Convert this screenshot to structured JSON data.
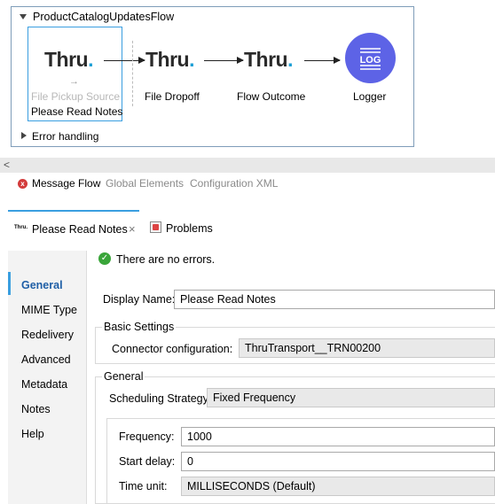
{
  "canvas": {
    "flow_name": "ProductCatalogUpdatesFlow",
    "nodes": [
      {
        "logo": "Thru",
        "label": "File Pickup Source"
      },
      {
        "logo": "Thru",
        "label": "File Dropoff"
      },
      {
        "logo": "Thru",
        "label": "Flow Outcome"
      },
      {
        "logo": "LOG",
        "label": "Logger"
      }
    ],
    "selected_label": "Please Read Notes",
    "error_handling": "Error handling",
    "accent_color": "#3a9ee0",
    "logger_color": "#5d63e6",
    "logo_dot": "."
  },
  "scrollbar": {
    "left_arrow": "<"
  },
  "editor_tabs": {
    "message_flow": "Message Flow",
    "global_elements": "Global Elements",
    "configuration_xml": "Configuration XML",
    "error_badge": "x"
  },
  "properties": {
    "tab_mini_logo": "Thru.",
    "tab_label": "Please Read Notes",
    "tab_close": "×",
    "problems": "Problems",
    "nav": [
      "General",
      "MIME Type",
      "Redelivery",
      "Advanced",
      "Metadata",
      "Notes",
      "Help"
    ],
    "status_icon": "✓",
    "status": "There are no errors.",
    "display_name_label": "Display Name:",
    "display_name_value": "Please Read Notes",
    "basic_settings": "Basic Settings",
    "connector_label": "Connector configuration:",
    "connector_value": "ThruTransport__TRN00200",
    "general_group": "General",
    "scheduling_label": "Scheduling Strategy",
    "scheduling_value": "Fixed Frequency",
    "frequency_label": "Frequency:",
    "frequency_value": "1000",
    "start_delay_label": "Start delay:",
    "start_delay_value": "0",
    "time_unit_label": "Time unit:",
    "time_unit_value": "MILLISECONDS (Default)"
  }
}
